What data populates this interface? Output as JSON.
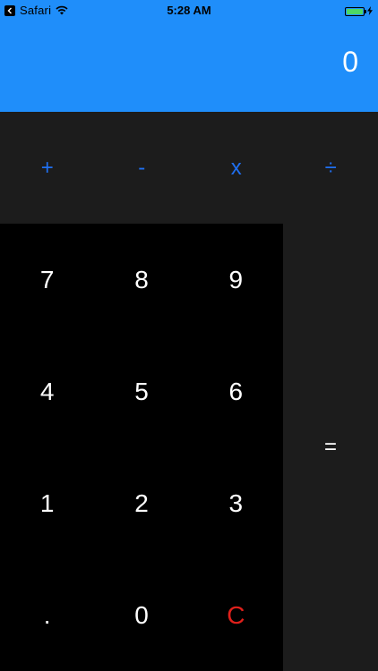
{
  "status_bar": {
    "app_name": "Safari",
    "time": "5:28 AM",
    "battery_color": "#4cd964"
  },
  "display": {
    "value": "0",
    "background": "#1f8efa"
  },
  "operators": [
    {
      "label": "+",
      "name": "add"
    },
    {
      "label": "-",
      "name": "subtract"
    },
    {
      "label": "x",
      "name": "multiply"
    },
    {
      "label": "÷",
      "name": "divide"
    }
  ],
  "keypad": [
    {
      "label": "7"
    },
    {
      "label": "8"
    },
    {
      "label": "9"
    },
    {
      "label": "4"
    },
    {
      "label": "5"
    },
    {
      "label": "6"
    },
    {
      "label": "1"
    },
    {
      "label": "2"
    },
    {
      "label": "3"
    },
    {
      "label": "."
    },
    {
      "label": "0"
    },
    {
      "label": "C"
    }
  ],
  "equals": {
    "label": "="
  },
  "colors": {
    "operator_text": "#1f6ff0",
    "clear_text": "#e0201b",
    "pad_background": "#000000",
    "panel_background": "#1c1c1c"
  }
}
